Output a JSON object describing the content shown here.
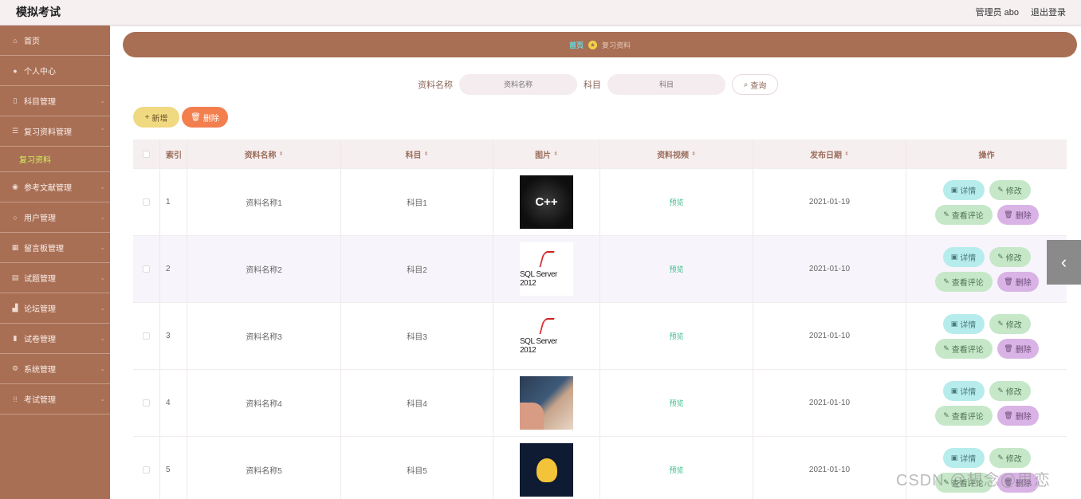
{
  "header": {
    "app_title": "模拟考试",
    "user_info": "管理员 abo",
    "logout": "退出登录"
  },
  "sidebar": {
    "items": [
      {
        "label": "首页",
        "icon": "home-icon"
      },
      {
        "label": "个人中心",
        "icon": "user-icon"
      },
      {
        "label": "科目管理",
        "icon": "phone-icon"
      },
      {
        "label": "复习资料管理",
        "icon": "list-icon"
      },
      {
        "label": "参考文献管理",
        "icon": "pin-icon"
      },
      {
        "label": "用户管理",
        "icon": "circle-icon"
      },
      {
        "label": "留言板管理",
        "icon": "grid-icon"
      },
      {
        "label": "试题管理",
        "icon": "doc-icon"
      },
      {
        "label": "论坛管理",
        "icon": "chart-icon"
      },
      {
        "label": "试卷管理",
        "icon": "book-icon"
      },
      {
        "label": "系统管理",
        "icon": "gear-icon"
      },
      {
        "label": "考试管理",
        "icon": "apps-icon"
      }
    ],
    "sub_active": "复习资料"
  },
  "breadcrumb": {
    "home": "首页",
    "current": "复习资料"
  },
  "search": {
    "name_label": "资料名称",
    "name_placeholder": "资料名称",
    "subject_label": "科目",
    "subject_placeholder": "科目",
    "query_button": "查询"
  },
  "actions": {
    "add": "新增",
    "delete": "删除"
  },
  "table": {
    "headers": {
      "index": "索引",
      "name": "资料名称",
      "subject": "科目",
      "image": "图片",
      "video": "资料视频",
      "date": "发布日期",
      "ops": "操作"
    },
    "rows": [
      {
        "index": "1",
        "name": "资料名称1",
        "subject": "科目1",
        "video": "预览",
        "date": "2021-01-19",
        "image_text": "C++"
      },
      {
        "index": "2",
        "name": "资料名称2",
        "subject": "科目2",
        "video": "预览",
        "date": "2021-01-10",
        "image_text": "SQL Server 2012"
      },
      {
        "index": "3",
        "name": "资料名称3",
        "subject": "科目3",
        "video": "预览",
        "date": "2021-01-10",
        "image_text": "SQL Server 2012"
      },
      {
        "index": "4",
        "name": "资料名称4",
        "subject": "科目4",
        "video": "预览",
        "date": "2021-01-10",
        "image_text": ""
      },
      {
        "index": "5",
        "name": "资料名称5",
        "subject": "科目5",
        "video": "预览",
        "date": "2021-01-10",
        "image_text": ""
      }
    ],
    "op_labels": {
      "detail": "详情",
      "edit": "修改",
      "review": "查看评论",
      "delete": "删除"
    }
  },
  "watermark": "CSDN @想念@思恋",
  "colors": {
    "sidebar": "#a86f55",
    "breadcrumb": "#a86f55",
    "add_button": "#f0d980",
    "delete_button": "#f37f4f",
    "detail_button": "#b6ecec",
    "edit_button": "#c6e8c9",
    "op_delete_button": "#d9b3e6",
    "video_link": "#3cbf8a"
  }
}
